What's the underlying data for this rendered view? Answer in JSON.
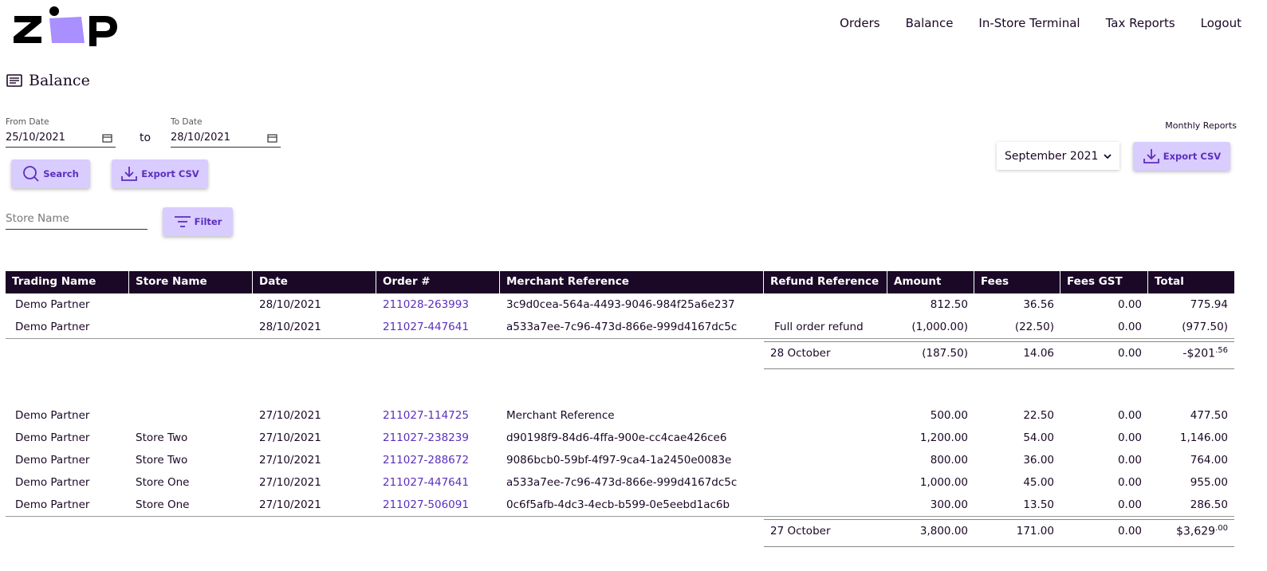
{
  "nav": {
    "items": [
      "Orders",
      "Balance",
      "In-Store Terminal",
      "Tax Reports",
      "Logout"
    ]
  },
  "page": {
    "title": "Balance"
  },
  "filters": {
    "from_label": "From Date",
    "from_value": "25/10/2021",
    "to_text": "to",
    "to_label": "To Date",
    "to_value": "28/10/2021",
    "search_label": "Search",
    "export_label": "Export CSV",
    "store_placeholder": "Store Name",
    "filter_label": "Filter"
  },
  "monthly": {
    "label": "Monthly Reports",
    "selected": "September 2021",
    "export_label": "Export CSV"
  },
  "colors": {
    "accent": "#d9ccff",
    "accent_text": "#5b2fbf",
    "header_bg": "#1a0826"
  },
  "table": {
    "headers": [
      "Trading Name",
      "Store Name",
      "Date",
      "Order #",
      "Merchant Reference",
      "Refund Reference",
      "Amount",
      "Fees",
      "Fees GST",
      "Total"
    ],
    "groups": [
      {
        "rows": [
          [
            "Demo Partner",
            "",
            "28/10/2021",
            "211028-263993",
            "3c9d0cea-564a-4493-9046-984f25a6e237",
            "",
            "812.50",
            "36.56",
            "0.00",
            "775.94"
          ],
          [
            "Demo Partner",
            "",
            "28/10/2021",
            "211027-447641",
            "a533a7ee-7c96-473d-866e-999d4167dc5c",
            "Full order refund",
            "(1,000.00)",
            "(22.50)",
            "0.00",
            "(977.50)"
          ]
        ],
        "subtotal": {
          "label": "28 October",
          "amount": "(187.50)",
          "fees": "14.06",
          "gst": "0.00",
          "total_main": "-$201",
          "total_cents": ".56"
        }
      },
      {
        "rows": [
          [
            "Demo Partner",
            "",
            "27/10/2021",
            "211027-114725",
            "Merchant Reference",
            "",
            "500.00",
            "22.50",
            "0.00",
            "477.50"
          ],
          [
            "Demo Partner",
            "Store Two",
            "27/10/2021",
            "211027-238239",
            "d90198f9-84d6-4ffa-900e-cc4cae426ce6",
            "",
            "1,200.00",
            "54.00",
            "0.00",
            "1,146.00"
          ],
          [
            "Demo Partner",
            "Store Two",
            "27/10/2021",
            "211027-288672",
            "9086bcb0-59bf-4f97-9ca4-1a2450e0083e",
            "",
            "800.00",
            "36.00",
            "0.00",
            "764.00"
          ],
          [
            "Demo Partner",
            "Store One",
            "27/10/2021",
            "211027-447641",
            "a533a7ee-7c96-473d-866e-999d4167dc5c",
            "",
            "1,000.00",
            "45.00",
            "0.00",
            "955.00"
          ],
          [
            "Demo Partner",
            "Store One",
            "27/10/2021",
            "211027-506091",
            "0c6f5afb-4dc3-4ecb-b599-0e5eebd1ac6b",
            "",
            "300.00",
            "13.50",
            "0.00",
            "286.50"
          ]
        ],
        "subtotal": {
          "label": "27 October",
          "amount": "3,800.00",
          "fees": "171.00",
          "gst": "0.00",
          "total_main": "$3,629",
          "total_cents": ".00"
        }
      }
    ]
  }
}
